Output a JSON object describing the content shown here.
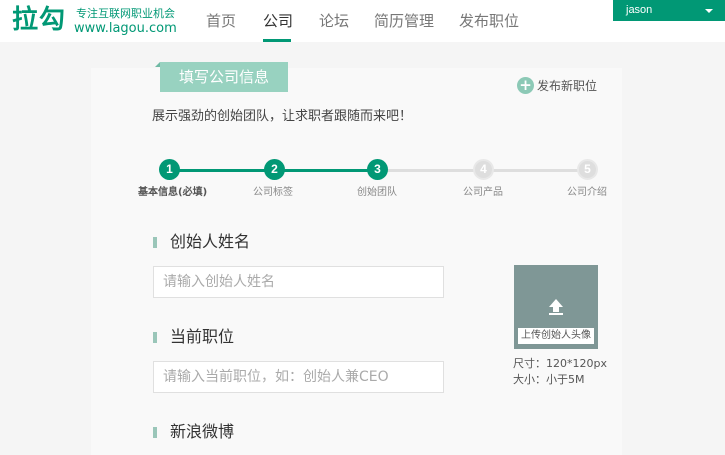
{
  "header": {
    "logo": "拉勾",
    "slogan": "专注互联网职业机会",
    "url": "www.lagou.com",
    "nav": [
      "首页",
      "公司",
      "论坛",
      "简历管理",
      "发布职位"
    ],
    "active_nav": "公司",
    "user": "jason"
  },
  "page": {
    "title": "填写公司信息",
    "publish_link": "发布新职位",
    "intro": "展示强劲的创始团队，让求职者跟随而来吧！"
  },
  "steps": [
    {
      "number": "1",
      "label": "基本信息(必填)",
      "state": "done"
    },
    {
      "number": "2",
      "label": "公司标签",
      "state": "done"
    },
    {
      "number": "3",
      "label": "创始团队",
      "state": "current"
    },
    {
      "number": "4",
      "label": "公司产品",
      "state": "todo"
    },
    {
      "number": "5",
      "label": "公司介绍",
      "state": "todo"
    }
  ],
  "form": {
    "founder_name": {
      "label": "创始人姓名",
      "value": "",
      "placeholder": "请输入创始人姓名"
    },
    "position": {
      "label": "当前职位",
      "value": "",
      "placeholder": "请输入当前职位，如：创始人兼CEO"
    },
    "weibo": {
      "label": "新浪微博"
    }
  },
  "avatar": {
    "upload_label": "上传创始人头像",
    "size_note": "尺寸：120*120px",
    "filesize_note": "大小：小于5M"
  },
  "colors": {
    "brand": "#019875",
    "title_tag": "#98d2c0",
    "step_todo": "#dedede",
    "avatar_bg": "#7f9796"
  }
}
